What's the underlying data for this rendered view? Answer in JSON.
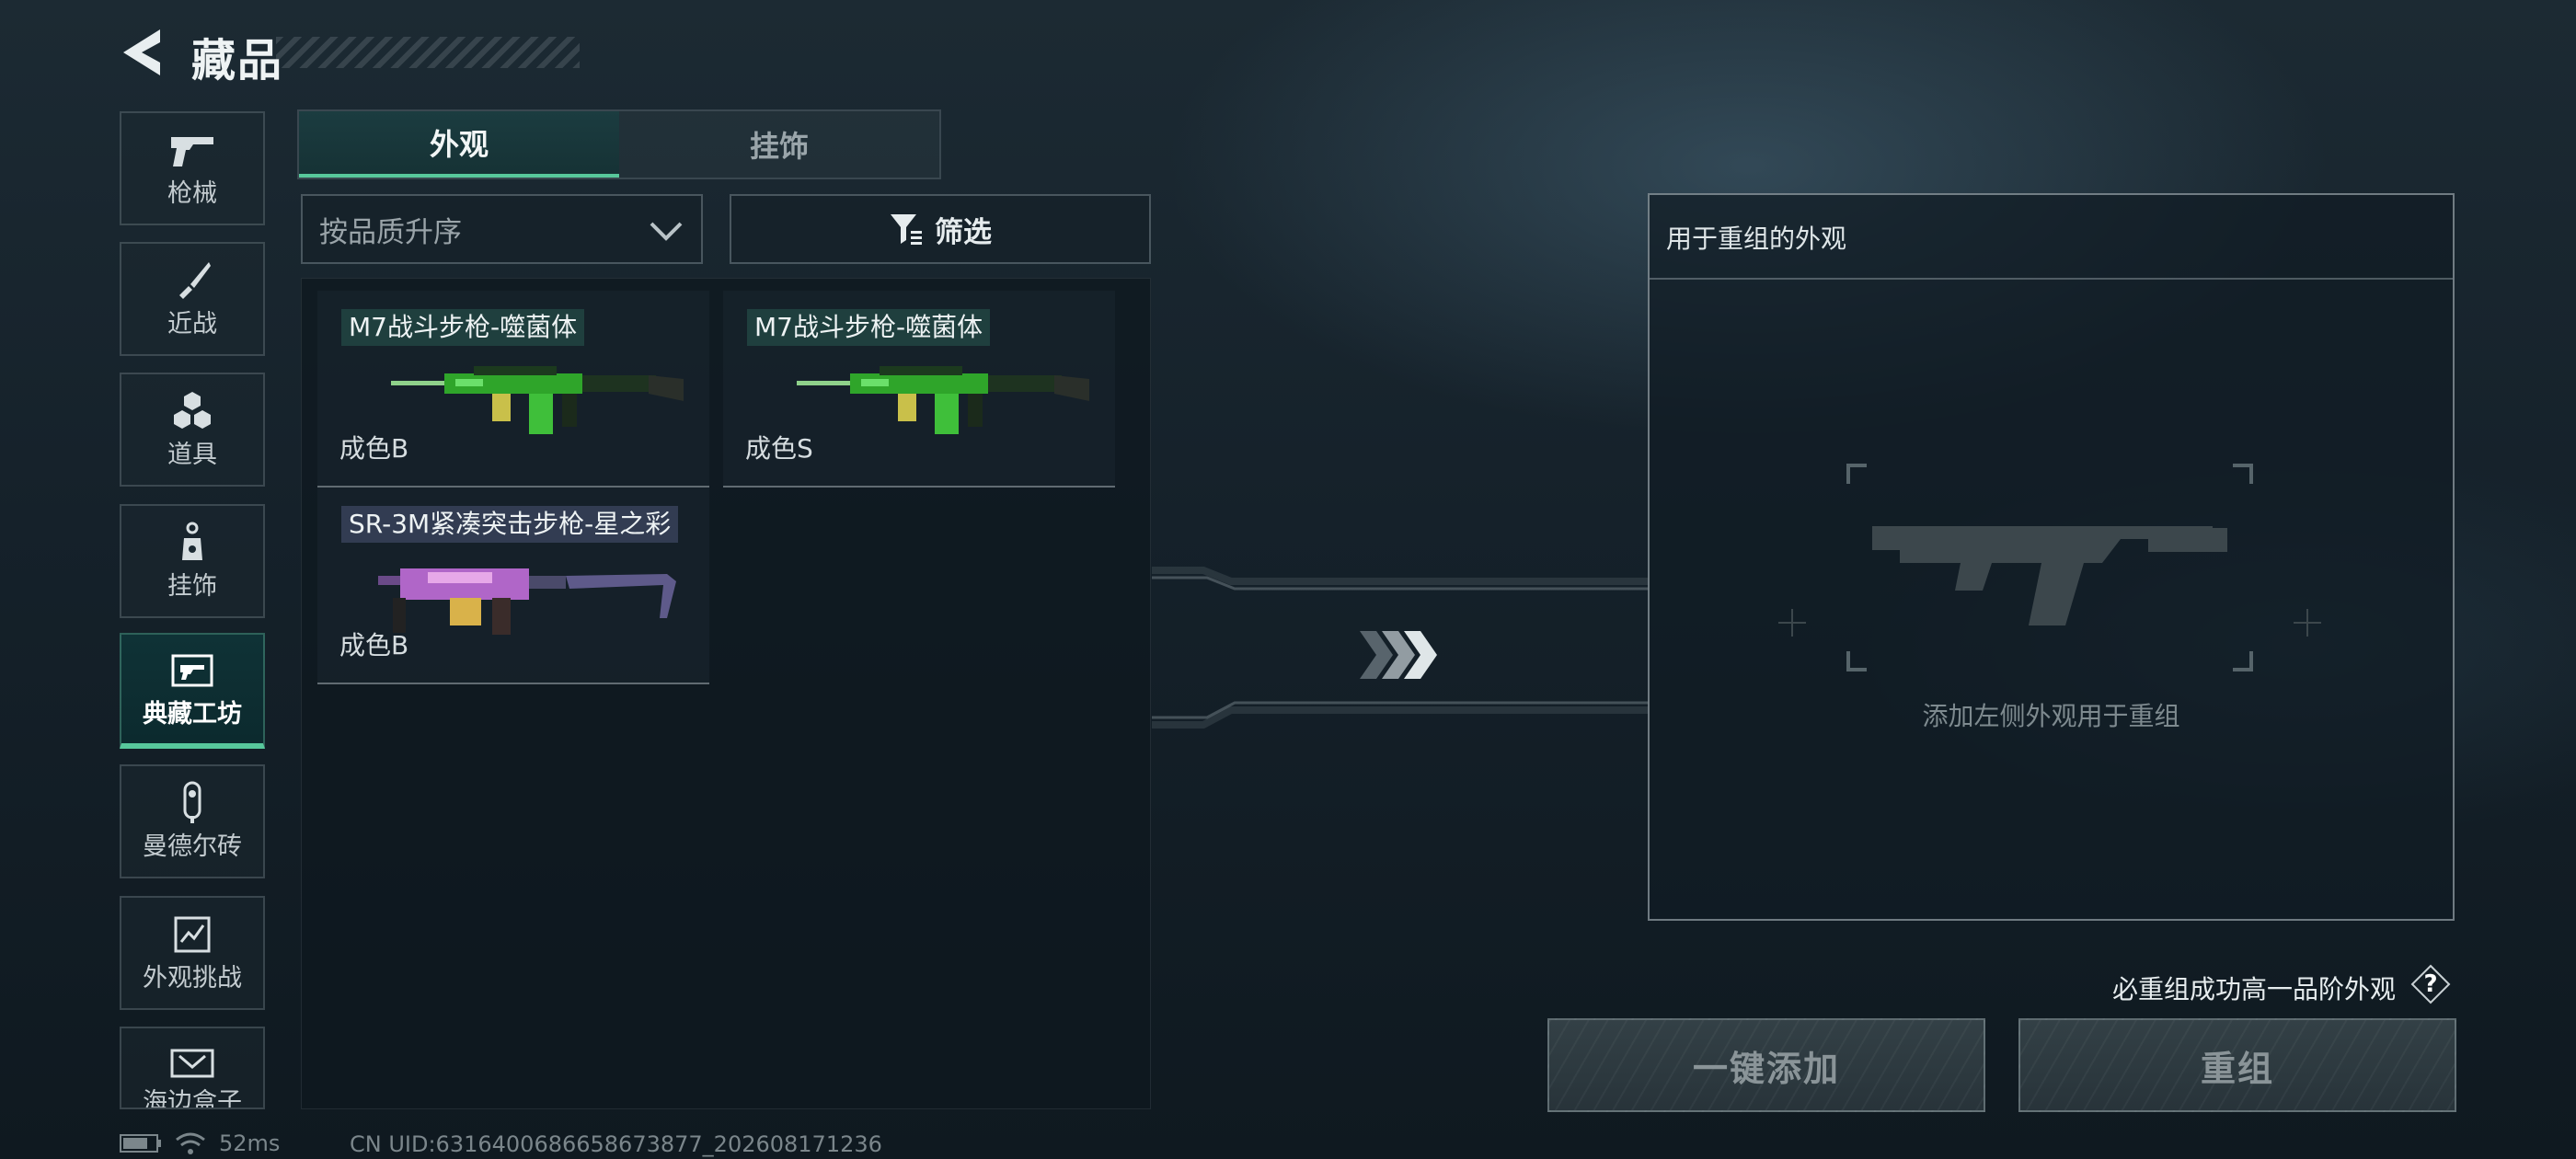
{
  "header": {
    "title": "藏品",
    "back_icon": "back-arrow-icon"
  },
  "sidebar": {
    "items": [
      {
        "label": "枪械",
        "icon": "pistol-icon",
        "active": false
      },
      {
        "label": "近战",
        "icon": "knife-icon",
        "active": false
      },
      {
        "label": "道具",
        "icon": "grenade-cluster-icon",
        "active": false
      },
      {
        "label": "挂饰",
        "icon": "charm-icon",
        "active": false
      },
      {
        "label": "典藏工坊",
        "icon": "workshop-card-icon",
        "active": true
      },
      {
        "label": "曼德尔砖",
        "icon": "mandel-brick-icon",
        "active": false
      },
      {
        "label": "外观挑战",
        "icon": "challenge-chart-icon",
        "active": false
      },
      {
        "label": "海边盒子",
        "icon": "box-icon",
        "active": false
      }
    ]
  },
  "tabs": [
    {
      "label": "外观",
      "active": true
    },
    {
      "label": "挂饰",
      "active": false
    }
  ],
  "sort": {
    "value": "按品质升序"
  },
  "filter": {
    "label": "筛选"
  },
  "skins": [
    {
      "name": "M7战斗步枪-噬菌体",
      "grade": "成色B"
    },
    {
      "name": "M7战斗步枪-噬菌体",
      "grade": "成色S"
    },
    {
      "name": "SR-3M紧凑突击步枪-星之彩",
      "grade": "成色B"
    }
  ],
  "recombine": {
    "title": "用于重组的外观",
    "hint": "添加左侧外观用于重组",
    "guarantee": "必重组成功高一品阶外观",
    "help": "?",
    "add_all": "一键添加",
    "recombine": "重组"
  },
  "status": {
    "ping": "52ms",
    "uid": "CN UID:6316400686658673877_202608171236"
  },
  "colors": {
    "accent": "#57c79b",
    "background": "#15212a",
    "phage_skin": "#2fa52a",
    "stellar_skin": "#b066c8"
  }
}
